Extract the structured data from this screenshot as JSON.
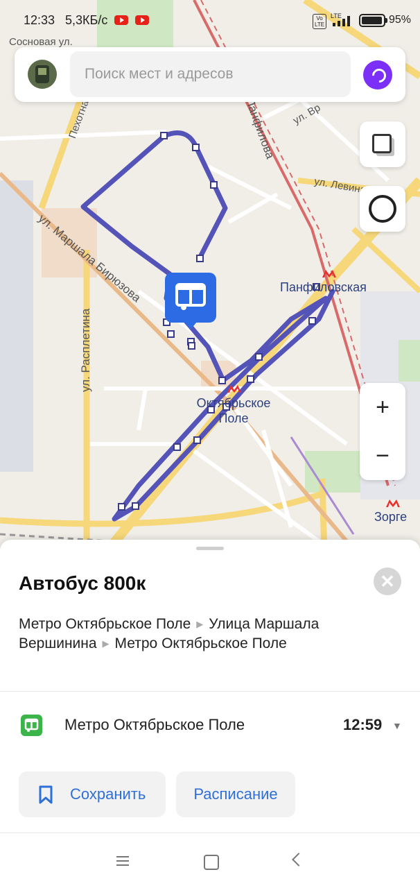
{
  "status_bar": {
    "time": "12:33",
    "net_speed": "5,3КБ/с",
    "volte": "Vo LTE",
    "lte": "LTE",
    "battery_percent": "95%",
    "battery_level": 0.95
  },
  "search": {
    "placeholder": "Поиск мест и адресов",
    "avatar_icon": "user-avatar",
    "assistant_icon": "alice-icon"
  },
  "map": {
    "street_labels": [
      "Сосновая ул.",
      "Пехотная",
      "ул. Маршала Бирюзова",
      "ул. Расплетина",
      "Панфилова",
      "ул. Левина",
      "ул. Вр",
      "Панфиловская",
      "Октябрьское Поле",
      "Зорге"
    ],
    "metro_stations": [
      {
        "name": "Панфиловская"
      },
      {
        "name": "Октябрьское\nПоле"
      },
      {
        "name": "Зорге"
      }
    ],
    "route_color": "#5353b8",
    "metro_color": "#e8312d",
    "controls": {
      "zoom_in": "+",
      "zoom_out": "−"
    }
  },
  "sheet": {
    "title": "Автобус 800к",
    "close_label": "✕",
    "route_stops": [
      "Метро Октябрьское Поле",
      "Улица Маршала Вершинина",
      "Метро Октябрьское Поле"
    ],
    "next_stop": {
      "name": "Метро Октябрьское Поле",
      "time": "12:59"
    },
    "save_label": "Сохранить",
    "schedule_label": "Расписание",
    "accent_color": "#2f6fd8"
  }
}
